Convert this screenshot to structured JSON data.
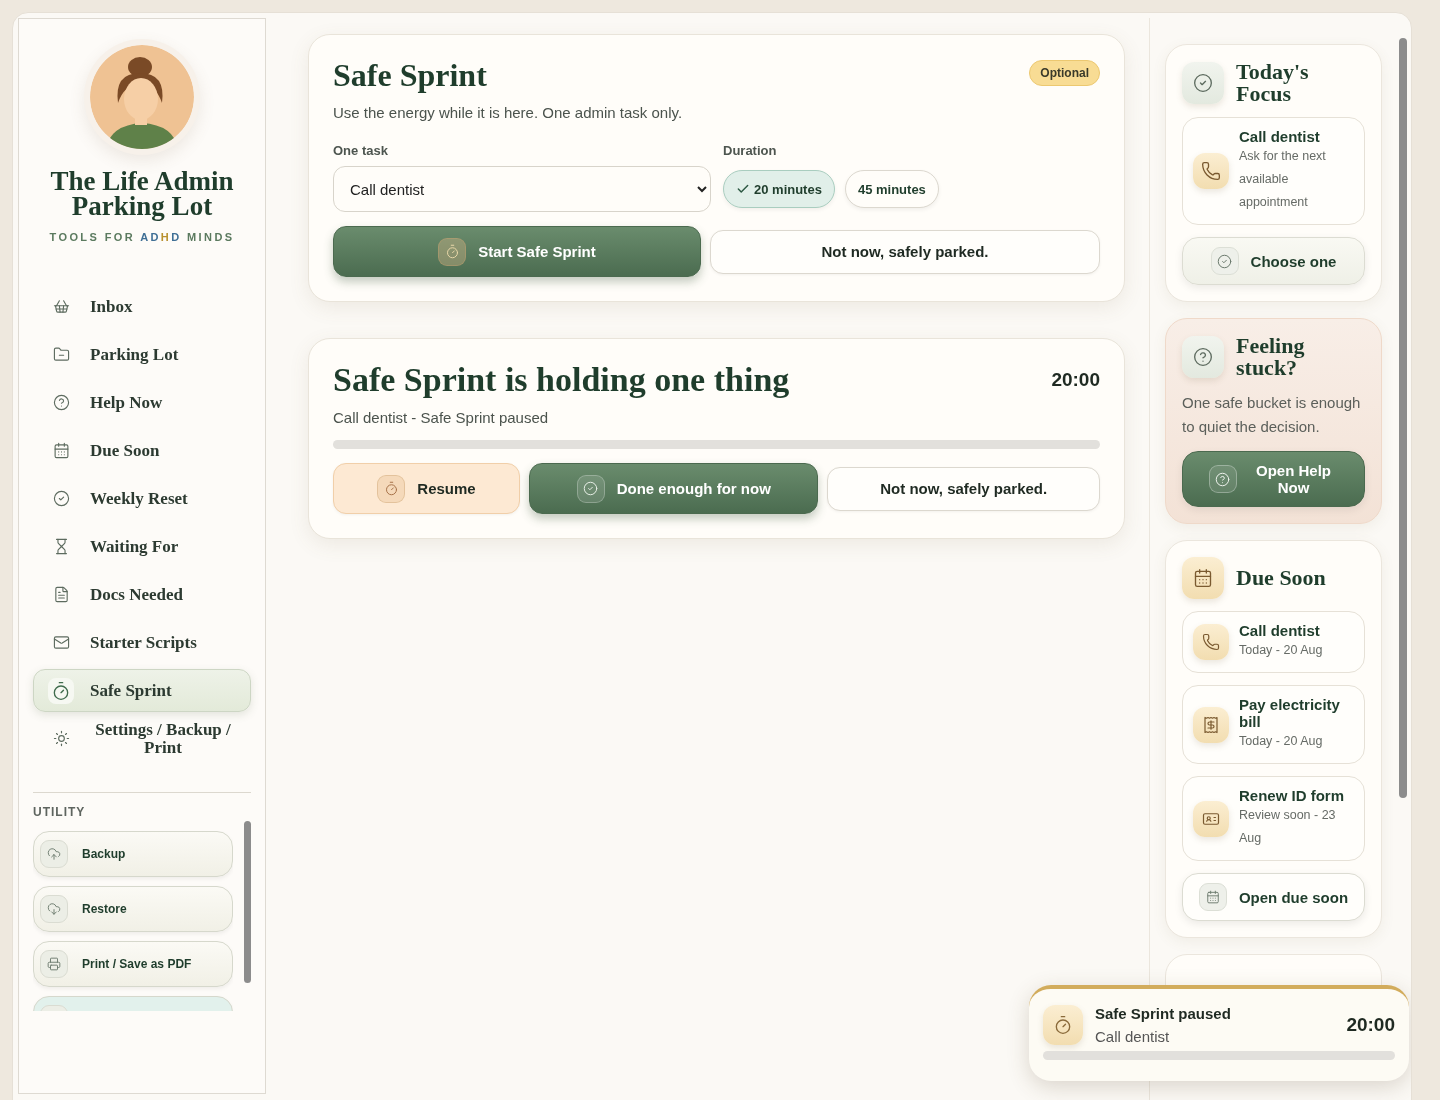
{
  "sidebar": {
    "brand": {
      "title": "The Life Admin Parking Lot",
      "tagline": [
        {
          "text": "TOOLS FOR ",
          "color": "#5b7a5f"
        },
        {
          "text": "AD",
          "color": "#3f6f95"
        },
        {
          "text": "H",
          "color": "#b8902e"
        },
        {
          "text": "D",
          "color": "#3f6f95"
        },
        {
          "text": " MINDS",
          "color": "#5b7a5f"
        }
      ]
    },
    "nav": [
      {
        "label": "Inbox",
        "selected": false
      },
      {
        "label": "Parking Lot",
        "selected": false
      },
      {
        "label": "Help Now",
        "selected": false
      },
      {
        "label": "Due Soon",
        "selected": false
      },
      {
        "label": "Weekly Reset",
        "selected": false
      },
      {
        "label": "Waiting For",
        "selected": false
      },
      {
        "label": "Docs Needed",
        "selected": false
      },
      {
        "label": "Starter Scripts",
        "selected": false
      },
      {
        "label": "Safe Sprint",
        "selected": true
      },
      {
        "label": "Settings / Backup / Print",
        "selected": false
      }
    ],
    "utility": {
      "heading": "UTILITY",
      "items": [
        {
          "label": "Backup",
          "kind": "plain"
        },
        {
          "label": "Restore",
          "kind": "plain"
        },
        {
          "label": "Print / Save as PDF",
          "kind": "plain"
        },
        {
          "kind": "accent"
        }
      ]
    }
  },
  "sprint_setup": {
    "title": "Safe Sprint",
    "badge": "Optional",
    "subtitle": "Use the energy while it is here. One admin task only.",
    "task_label": "One task",
    "task_value": "Call dentist",
    "duration_label": "Duration",
    "durations": [
      {
        "label": "20 minutes",
        "selected": true
      },
      {
        "label": "45 minutes",
        "selected": false
      }
    ],
    "start_button": "Start Safe Sprint",
    "park_button": "Not now, safely parked."
  },
  "sprint_status": {
    "title": "Safe Sprint is holding one thing",
    "timer": "20:00",
    "subtitle": "Call dentist - Safe Sprint paused",
    "level": 0,
    "buttons": [
      {
        "label": "Resume",
        "kind": "resume"
      },
      {
        "label": "Done enough for now",
        "kind": "primary"
      },
      {
        "label": "Not now, safely parked.",
        "kind": "plain"
      }
    ]
  },
  "right_panel": {
    "focus": {
      "title": "Today's Focus",
      "task": {
        "title": "Call dentist",
        "note": "Ask for the next available appointment"
      },
      "button": "Choose one"
    },
    "stuck": {
      "title": "Feeling stuck?",
      "text": "One safe bucket is enough to quiet the decision.",
      "button": "Open Help Now"
    },
    "due_soon": {
      "title": "Due Soon",
      "items": [
        {
          "title": "Call dentist",
          "note": "Today - 20 Aug"
        },
        {
          "title": "Pay electricity bill",
          "note": "Today - 20 Aug"
        },
        {
          "title": "Renew ID form",
          "note": "Review soon - 23 Aug"
        }
      ],
      "button": "Open due soon"
    }
  },
  "toast": {
    "title": "Safe Sprint paused",
    "subtitle": "Call dentist",
    "timer": "20:00",
    "level": 0
  }
}
